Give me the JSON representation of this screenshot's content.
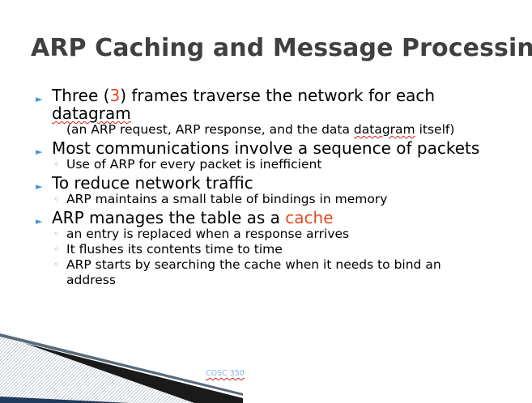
{
  "slide": {
    "title": "ARP Caching and Message Processing",
    "footer": "COSC 350",
    "colors": {
      "accent": "#e8491d",
      "bullet": "#4a90d0",
      "title": "#404040",
      "footer": "#8db3e2"
    },
    "icons": {
      "level1": "triangle-bullet-icon",
      "level2": "circle-bullet-icon"
    },
    "bullets": {
      "b1": {
        "pre": "Three (",
        "highlight": "3",
        "post": ") frames traverse the network for each",
        "cont": "datagram"
      },
      "b1_sub": {
        "pre": "(an ARP request, ARP response, and the data ",
        "word": "datagram",
        "post": " itself)"
      },
      "b2": "Most communications involve a sequence of packets",
      "b2_sub": "Use of ARP for every packet is inefficient",
      "b3": "To reduce network traffic",
      "b3_sub": "ARP maintains a small table of bindings in memory",
      "b4": {
        "pre": "ARP manages the table as a ",
        "highlight": "cache"
      },
      "b4_subs": [
        "an entry is replaced when a response arrives",
        "It flushes its contents time to time",
        "ARP starts by searching the cache when it needs to bind an"
      ],
      "b4_sub3_cont": "address"
    }
  }
}
